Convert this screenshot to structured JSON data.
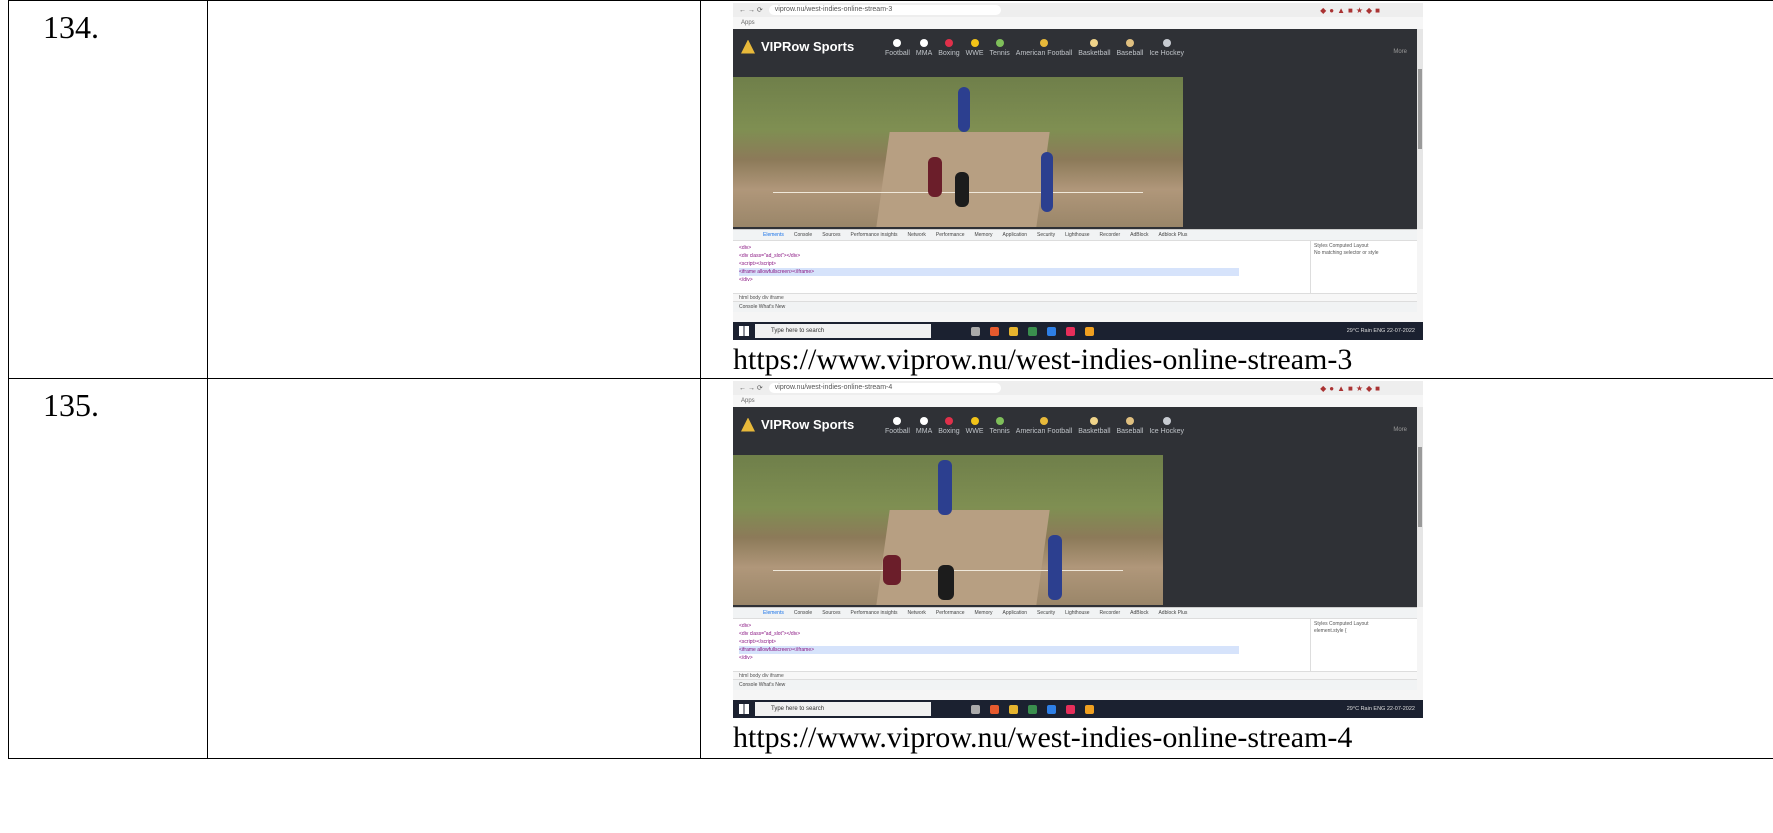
{
  "rows": [
    {
      "number": "134.",
      "description": "",
      "url_caption": "https://www.viprow.nu/west-indies-online-stream-3",
      "screenshot": {
        "address": "viprow.nu/west-indies-online-stream-3",
        "bookmarks_label": "Apps",
        "site_name": "VIPRow Sports",
        "nav_items": [
          "Football",
          "MMA",
          "Boxing",
          "WWE",
          "Tennis",
          "American Football",
          "Basketball",
          "Baseball",
          "Ice Hockey"
        ],
        "more_label": "More",
        "devtools_tabs": [
          "Elements",
          "Console",
          "Sources",
          "Performance insights",
          "Network",
          "Performance",
          "Memory",
          "Application",
          "Security",
          "Lighthouse",
          "Recorder",
          "AdBlock",
          "Adblock Plus"
        ],
        "styles_tabs": "Styles  Computed  Layout",
        "no_matching": "No matching selector or style",
        "drawer_tabs": "Console   What's New",
        "search_placeholder": "Type here to search",
        "tray_text": "29°C Rain  ENG 22-07-2022"
      }
    },
    {
      "number": "135.",
      "description": "",
      "url_caption": "https://www.viprow.nu/west-indies-online-stream-4",
      "screenshot": {
        "address": "viprow.nu/west-indies-online-stream-4",
        "bookmarks_label": "Apps",
        "site_name": "VIPRow Sports",
        "nav_items": [
          "Football",
          "MMA",
          "Boxing",
          "WWE",
          "Tennis",
          "American Football",
          "Basketball",
          "Baseball",
          "Ice Hockey"
        ],
        "more_label": "More",
        "devtools_tabs": [
          "Elements",
          "Console",
          "Sources",
          "Performance insights",
          "Network",
          "Performance",
          "Memory",
          "Application",
          "Security",
          "Lighthouse",
          "Recorder",
          "AdBlock",
          "Adblock Plus"
        ],
        "styles_tabs": "Styles  Computed  Layout",
        "no_matching": "element.style {",
        "drawer_tabs": "Console   What's New",
        "search_placeholder": "Type here to search",
        "tray_text": "29°C Rain  ENG 22-07-2022"
      }
    }
  ],
  "colors": {
    "site_bg": "#2f3136",
    "taskbar": "#1b2130",
    "nav_icons": [
      "#ffffff",
      "#ffffff",
      "#e0304a",
      "#f2c318",
      "#7fbf5a",
      "#e8b93a",
      "#f0d48a",
      "#e0c080",
      "#c8ccd2"
    ]
  }
}
